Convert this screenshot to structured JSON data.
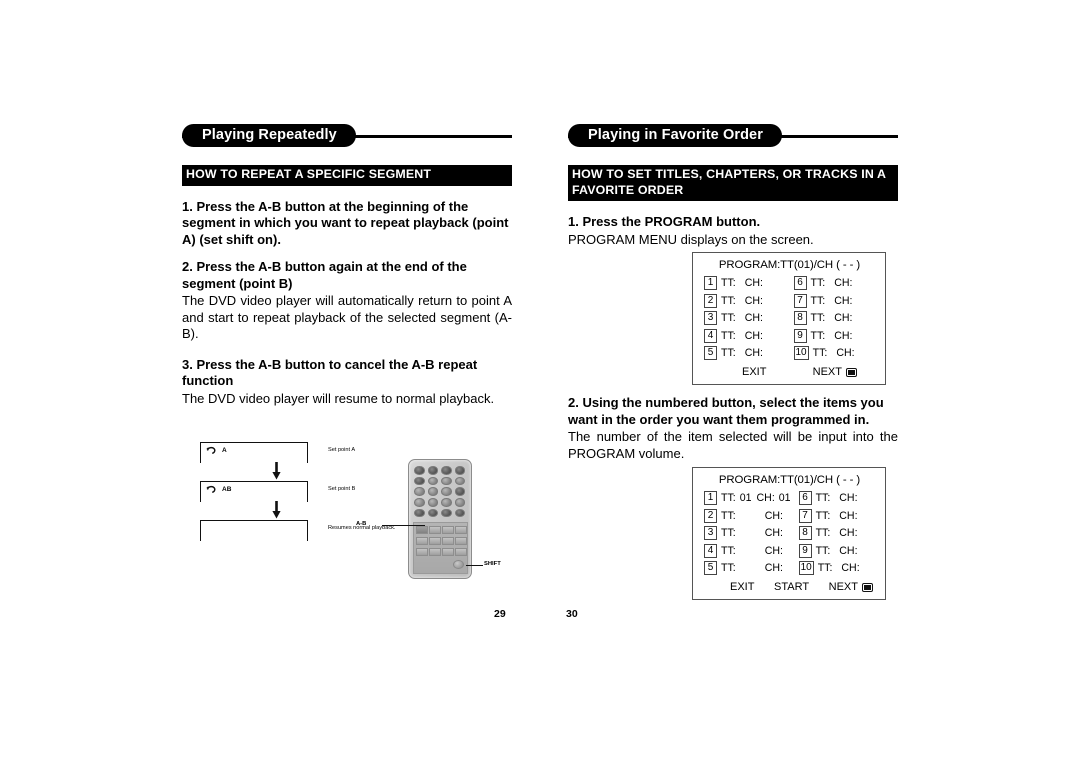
{
  "left_column": {
    "banner_title": "Playing Repeatedly",
    "section_header": "HOW TO REPEAT A SPECIFIC SEGMENT",
    "steps": [
      {
        "heading": "1. Press the A-B button at the beginning of the segment in which you want to repeat playback (point A) (set shift on).",
        "body": ""
      },
      {
        "heading": "2. Press the A-B button again at the end of the segment (point B)",
        "body": "The DVD video player will automatically return to point A and start to repeat playback of the selected segment (A-B)."
      },
      {
        "heading": "3. Press the A-B button to cancel the A-B repeat function",
        "body": "The DVD video player will resume to normal playback."
      }
    ],
    "flow_diagram": {
      "rows": [
        {
          "icon": "repeat-loop-icon",
          "label": "A",
          "caption": "Set point A"
        },
        {
          "icon": "repeat-loop-icon",
          "label": "AB",
          "caption": "Set point B"
        },
        {
          "icon": "",
          "label": "",
          "caption": "Resumes normal playback."
        }
      ]
    },
    "remote": {
      "callouts": [
        {
          "name": "ab-button",
          "text": "A-B"
        },
        {
          "name": "shift-button",
          "text": "SHIFT"
        }
      ]
    },
    "page_number": "29"
  },
  "right_column": {
    "banner_title": "Playing in Favorite Order",
    "section_header": "HOW TO SET TITLES, CHAPTERS, OR TRACKS IN A FAVORITE ORDER",
    "steps": [
      {
        "heading": "1. Press the PROGRAM button.",
        "body": "PROGRAM MENU displays on the screen."
      },
      {
        "heading": "2. Using the numbered button, select the items you want in the order you want them programmed in.",
        "body": "The number of the item selected will be input into the PROGRAM volume."
      }
    ],
    "program_menu_1": {
      "title": "PROGRAM:TT(01)/CH ( - - )",
      "left_rows": [
        {
          "num": "1",
          "tt_label": "TT:",
          "tt_value": "",
          "ch_label": "CH:",
          "ch_value": ""
        },
        {
          "num": "2",
          "tt_label": "TT:",
          "tt_value": "",
          "ch_label": "CH:",
          "ch_value": ""
        },
        {
          "num": "3",
          "tt_label": "TT:",
          "tt_value": "",
          "ch_label": "CH:",
          "ch_value": ""
        },
        {
          "num": "4",
          "tt_label": "TT:",
          "tt_value": "",
          "ch_label": "CH:",
          "ch_value": ""
        },
        {
          "num": "5",
          "tt_label": "TT:",
          "tt_value": "",
          "ch_label": "CH:",
          "ch_value": ""
        }
      ],
      "right_rows": [
        {
          "num": "6",
          "tt_label": "TT:",
          "tt_value": "",
          "ch_label": "CH:",
          "ch_value": ""
        },
        {
          "num": "7",
          "tt_label": "TT:",
          "tt_value": "",
          "ch_label": "CH:",
          "ch_value": ""
        },
        {
          "num": "8",
          "tt_label": "TT:",
          "tt_value": "",
          "ch_label": "CH:",
          "ch_value": ""
        },
        {
          "num": "9",
          "tt_label": "TT:",
          "tt_value": "",
          "ch_label": "CH:",
          "ch_value": ""
        },
        {
          "num": "10",
          "tt_label": "TT:",
          "tt_value": "",
          "ch_label": "CH:",
          "ch_value": ""
        }
      ],
      "buttons": {
        "exit": "EXIT",
        "next": "NEXT"
      }
    },
    "program_menu_2": {
      "title": "PROGRAM:TT(01)/CH ( - - )",
      "left_rows": [
        {
          "num": "1",
          "tt_label": "TT:",
          "tt_value": "01",
          "ch_label": "CH:",
          "ch_value": "01"
        },
        {
          "num": "2",
          "tt_label": "TT:",
          "tt_value": "",
          "ch_label": "CH:",
          "ch_value": ""
        },
        {
          "num": "3",
          "tt_label": "TT:",
          "tt_value": "",
          "ch_label": "CH:",
          "ch_value": ""
        },
        {
          "num": "4",
          "tt_label": "TT:",
          "tt_value": "",
          "ch_label": "CH:",
          "ch_value": ""
        },
        {
          "num": "5",
          "tt_label": "TT:",
          "tt_value": "",
          "ch_label": "CH:",
          "ch_value": ""
        }
      ],
      "right_rows": [
        {
          "num": "6",
          "tt_label": "TT:",
          "tt_value": "",
          "ch_label": "CH:",
          "ch_value": ""
        },
        {
          "num": "7",
          "tt_label": "TT:",
          "tt_value": "",
          "ch_label": "CH:",
          "ch_value": ""
        },
        {
          "num": "8",
          "tt_label": "TT:",
          "tt_value": "",
          "ch_label": "CH:",
          "ch_value": ""
        },
        {
          "num": "9",
          "tt_label": "TT:",
          "tt_value": "",
          "ch_label": "CH:",
          "ch_value": ""
        },
        {
          "num": "10",
          "tt_label": "TT:",
          "tt_value": "",
          "ch_label": "CH:",
          "ch_value": ""
        }
      ],
      "buttons": {
        "exit": "EXIT",
        "start": "START",
        "next": "NEXT"
      }
    },
    "page_number": "30"
  }
}
